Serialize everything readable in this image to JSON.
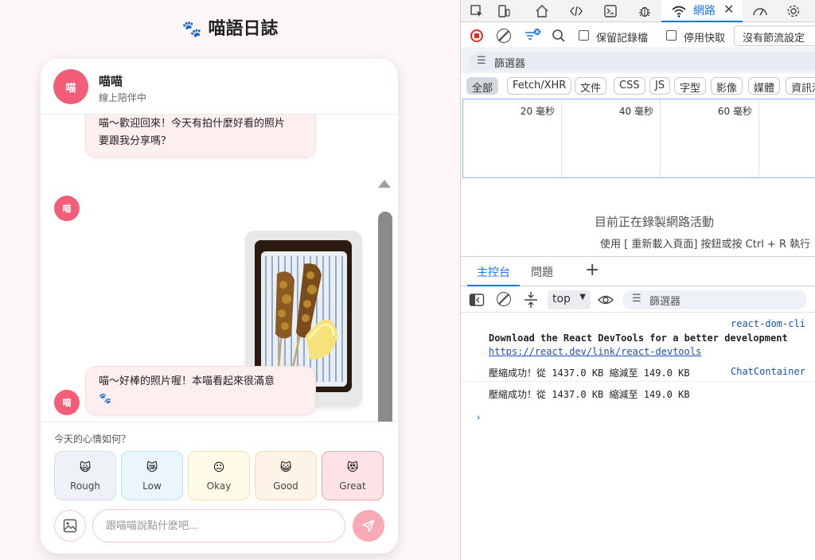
{
  "app": {
    "title": "喵語日誌",
    "title_icon": "paw-icon",
    "header": {
      "avatar": "喵",
      "name": "喵喵",
      "status": "線上陪伴中"
    },
    "messages": [
      {
        "sender": "cat",
        "avatar": "喵",
        "lines": [
          "喵～歡迎回來！今天有拍什麼好看的照片",
          "要跟我分享嗎？"
        ]
      },
      {
        "sender": "user",
        "type": "image",
        "alt": "grilled skewers with lemon"
      },
      {
        "sender": "cat",
        "avatar": "喵",
        "lines": [
          "喵～好棒的照片喔！本喵看起來很滿意",
          "🐾"
        ]
      }
    ],
    "mood": {
      "question": "今天的心情如何？",
      "options": [
        {
          "emoji": "🙀",
          "label": "Rough",
          "bg": "#eef1f6",
          "border": "#d8dee8"
        },
        {
          "emoji": "😿",
          "label": "Low",
          "bg": "#eaf6fb",
          "border": "#bfe3f2"
        },
        {
          "emoji": "😐",
          "label": "Okay",
          "bg": "#fffbe8",
          "border": "#f3e2a6"
        },
        {
          "emoji": "😺",
          "label": "Good",
          "bg": "#fdf3e7",
          "border": "#f3d9b9"
        },
        {
          "emoji": "😻",
          "label": "Great",
          "bg": "#fde3e6",
          "border": "#f1a4ae"
        }
      ]
    },
    "input": {
      "placeholder": "跟喵喵說點什麼吧..."
    },
    "colors": {
      "accent": "#f25e77",
      "send": "#f9aab6"
    }
  },
  "devtools": {
    "network_tab": "網路",
    "toolbar": {
      "preserve_log": "保留記錄檔",
      "disable_cache": "停用快取",
      "throttle": "沒有節流設定"
    },
    "filter_placeholder": "篩選器",
    "types": [
      "全部",
      "Fetch/XHR",
      "文件",
      "CSS",
      "JS",
      "字型",
      "影像",
      "媒體",
      "資訊清"
    ],
    "timeline": [
      "20 毫秒",
      "40 毫秒",
      "60 毫秒"
    ],
    "empty_title": "目前正在錄製網路活動",
    "empty_hint": "使用 [ 重新載入頁面] 按鈕或按 Ctrl + R 執行",
    "drawer_tabs": [
      "主控台",
      "問題"
    ],
    "console": {
      "context": "top",
      "filter_placeholder": "篩選器",
      "lines": {
        "src1": "react-dom-cli",
        "devtools_msg": "Download the React DevTools for a better development",
        "devtools_link": "https://react.dev/link/react-devtools",
        "log1_a": "壓縮成功！從",
        "log1_b": "1437.0 KB",
        "log1_c": "縮減至",
        "log1_d": "149.0 KB",
        "log1_src": "ChatContainer",
        "log2_a": "壓縮成功！從",
        "log2_b": "1437.0 KB",
        "log2_c": "縮減至",
        "log2_d": "149.0 KB"
      }
    }
  }
}
